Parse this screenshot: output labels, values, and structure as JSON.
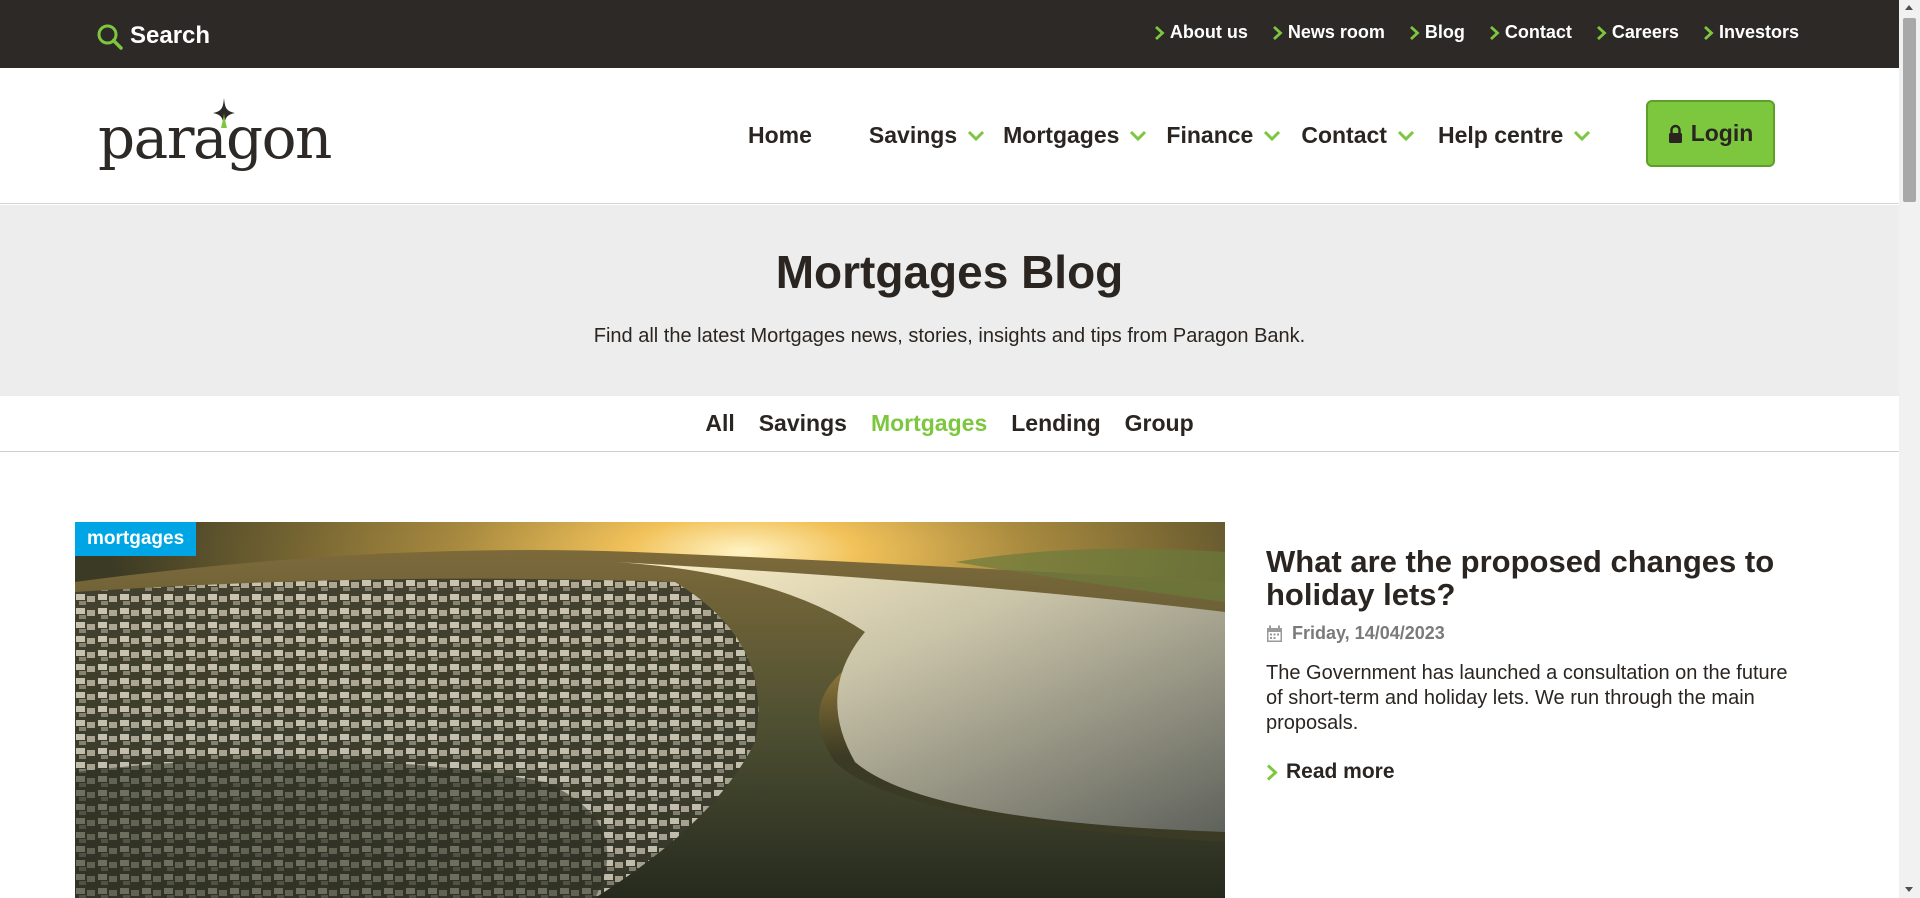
{
  "colors": {
    "brand_green": "#7dc73f",
    "dark": "#2d2926",
    "tag_blue": "#00a5e6",
    "hero_bg": "#ededed"
  },
  "topbar": {
    "search_label": "Search",
    "links": [
      "About us",
      "News room",
      "Blog",
      "Contact",
      "Careers",
      "Investors"
    ]
  },
  "header": {
    "logo_text": "paragon",
    "nav": [
      "Home",
      "Savings",
      "Mortgages",
      "Finance",
      "Contact",
      "Help centre"
    ],
    "login_label": "Login"
  },
  "hero": {
    "title": "Mortgages Blog",
    "subtitle": "Find all the latest Mortgages news, stories, insights and tips from Paragon Bank."
  },
  "tabs": {
    "items": [
      "All",
      "Savings",
      "Mortgages",
      "Lending",
      "Group"
    ],
    "active": "Mortgages"
  },
  "featured": {
    "tag": "mortgages",
    "title": "What are the proposed changes to holiday lets?",
    "date": "Friday, 14/04/2023",
    "excerpt": "The Government has launched a consultation on the future of short-term and holiday lets. We run through the main proposals.",
    "read_more": "Read more"
  },
  "icons": {
    "search": "search-icon",
    "chevron": "chevron-right-icon",
    "caret": "chevron-down-icon",
    "lock": "lock-icon",
    "calendar": "calendar-icon"
  }
}
